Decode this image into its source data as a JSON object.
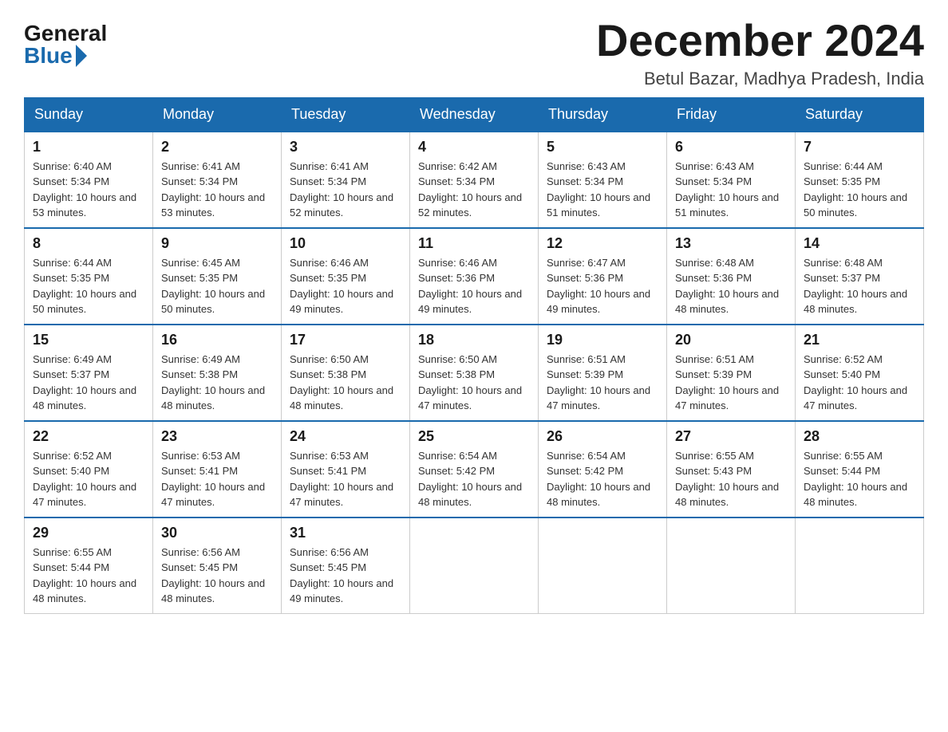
{
  "logo": {
    "general": "General",
    "blue": "Blue"
  },
  "header": {
    "month_year": "December 2024",
    "location": "Betul Bazar, Madhya Pradesh, India"
  },
  "days_of_week": [
    "Sunday",
    "Monday",
    "Tuesday",
    "Wednesday",
    "Thursday",
    "Friday",
    "Saturday"
  ],
  "weeks": [
    [
      {
        "day": "1",
        "sunrise": "6:40 AM",
        "sunset": "5:34 PM",
        "daylight": "10 hours and 53 minutes."
      },
      {
        "day": "2",
        "sunrise": "6:41 AM",
        "sunset": "5:34 PM",
        "daylight": "10 hours and 53 minutes."
      },
      {
        "day": "3",
        "sunrise": "6:41 AM",
        "sunset": "5:34 PM",
        "daylight": "10 hours and 52 minutes."
      },
      {
        "day": "4",
        "sunrise": "6:42 AM",
        "sunset": "5:34 PM",
        "daylight": "10 hours and 52 minutes."
      },
      {
        "day": "5",
        "sunrise": "6:43 AM",
        "sunset": "5:34 PM",
        "daylight": "10 hours and 51 minutes."
      },
      {
        "day": "6",
        "sunrise": "6:43 AM",
        "sunset": "5:34 PM",
        "daylight": "10 hours and 51 minutes."
      },
      {
        "day": "7",
        "sunrise": "6:44 AM",
        "sunset": "5:35 PM",
        "daylight": "10 hours and 50 minutes."
      }
    ],
    [
      {
        "day": "8",
        "sunrise": "6:44 AM",
        "sunset": "5:35 PM",
        "daylight": "10 hours and 50 minutes."
      },
      {
        "day": "9",
        "sunrise": "6:45 AM",
        "sunset": "5:35 PM",
        "daylight": "10 hours and 50 minutes."
      },
      {
        "day": "10",
        "sunrise": "6:46 AM",
        "sunset": "5:35 PM",
        "daylight": "10 hours and 49 minutes."
      },
      {
        "day": "11",
        "sunrise": "6:46 AM",
        "sunset": "5:36 PM",
        "daylight": "10 hours and 49 minutes."
      },
      {
        "day": "12",
        "sunrise": "6:47 AM",
        "sunset": "5:36 PM",
        "daylight": "10 hours and 49 minutes."
      },
      {
        "day": "13",
        "sunrise": "6:48 AM",
        "sunset": "5:36 PM",
        "daylight": "10 hours and 48 minutes."
      },
      {
        "day": "14",
        "sunrise": "6:48 AM",
        "sunset": "5:37 PM",
        "daylight": "10 hours and 48 minutes."
      }
    ],
    [
      {
        "day": "15",
        "sunrise": "6:49 AM",
        "sunset": "5:37 PM",
        "daylight": "10 hours and 48 minutes."
      },
      {
        "day": "16",
        "sunrise": "6:49 AM",
        "sunset": "5:38 PM",
        "daylight": "10 hours and 48 minutes."
      },
      {
        "day": "17",
        "sunrise": "6:50 AM",
        "sunset": "5:38 PM",
        "daylight": "10 hours and 48 minutes."
      },
      {
        "day": "18",
        "sunrise": "6:50 AM",
        "sunset": "5:38 PM",
        "daylight": "10 hours and 47 minutes."
      },
      {
        "day": "19",
        "sunrise": "6:51 AM",
        "sunset": "5:39 PM",
        "daylight": "10 hours and 47 minutes."
      },
      {
        "day": "20",
        "sunrise": "6:51 AM",
        "sunset": "5:39 PM",
        "daylight": "10 hours and 47 minutes."
      },
      {
        "day": "21",
        "sunrise": "6:52 AM",
        "sunset": "5:40 PM",
        "daylight": "10 hours and 47 minutes."
      }
    ],
    [
      {
        "day": "22",
        "sunrise": "6:52 AM",
        "sunset": "5:40 PM",
        "daylight": "10 hours and 47 minutes."
      },
      {
        "day": "23",
        "sunrise": "6:53 AM",
        "sunset": "5:41 PM",
        "daylight": "10 hours and 47 minutes."
      },
      {
        "day": "24",
        "sunrise": "6:53 AM",
        "sunset": "5:41 PM",
        "daylight": "10 hours and 47 minutes."
      },
      {
        "day": "25",
        "sunrise": "6:54 AM",
        "sunset": "5:42 PM",
        "daylight": "10 hours and 48 minutes."
      },
      {
        "day": "26",
        "sunrise": "6:54 AM",
        "sunset": "5:42 PM",
        "daylight": "10 hours and 48 minutes."
      },
      {
        "day": "27",
        "sunrise": "6:55 AM",
        "sunset": "5:43 PM",
        "daylight": "10 hours and 48 minutes."
      },
      {
        "day": "28",
        "sunrise": "6:55 AM",
        "sunset": "5:44 PM",
        "daylight": "10 hours and 48 minutes."
      }
    ],
    [
      {
        "day": "29",
        "sunrise": "6:55 AM",
        "sunset": "5:44 PM",
        "daylight": "10 hours and 48 minutes."
      },
      {
        "day": "30",
        "sunrise": "6:56 AM",
        "sunset": "5:45 PM",
        "daylight": "10 hours and 48 minutes."
      },
      {
        "day": "31",
        "sunrise": "6:56 AM",
        "sunset": "5:45 PM",
        "daylight": "10 hours and 49 minutes."
      },
      null,
      null,
      null,
      null
    ]
  ]
}
